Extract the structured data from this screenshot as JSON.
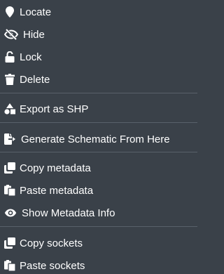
{
  "menu": {
    "items": [
      {
        "label": "Locate",
        "icon": "map-pin-icon"
      },
      {
        "label": "Hide",
        "icon": "eye-slash-icon"
      },
      {
        "label": "Lock",
        "icon": "unlock-icon"
      },
      {
        "label": "Delete",
        "icon": "trash-icon"
      },
      {
        "label": "Export as SHP",
        "icon": "shapes-icon"
      },
      {
        "label": "Generate Schematic From Here",
        "icon": "file-export-icon"
      },
      {
        "label": "Copy metadata",
        "icon": "copy-icon"
      },
      {
        "label": "Paste metadata",
        "icon": "paste-icon"
      },
      {
        "label": "Show Metadata Info",
        "icon": "eye-icon"
      },
      {
        "label": "Copy sockets",
        "icon": "copy-icon"
      },
      {
        "label": "Paste sockets",
        "icon": "paste-icon"
      }
    ]
  },
  "colors": {
    "background": "#3a4149",
    "text": "#ffffff",
    "divider": "#59616a"
  }
}
